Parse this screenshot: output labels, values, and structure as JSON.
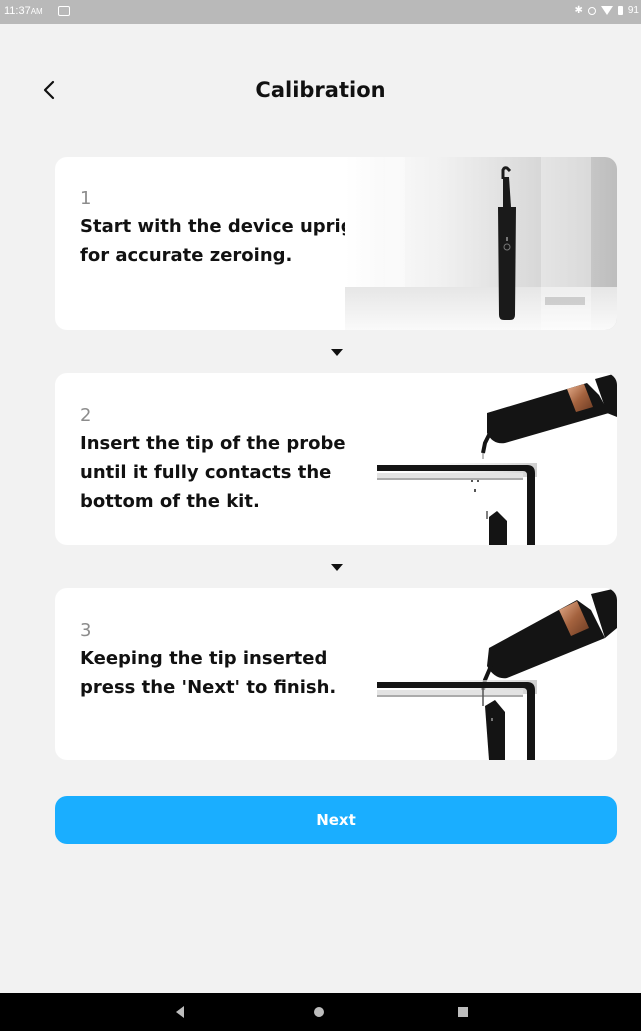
{
  "status_bar": {
    "time": "11:37",
    "time_suffix": "AM",
    "battery_level": "91"
  },
  "header": {
    "title": "Calibration",
    "back_icon": "chevron-left-icon"
  },
  "steps": [
    {
      "number": "1",
      "text": "Start with the device upright\nfor accurate zeroing.",
      "image": "device-upright-image"
    },
    {
      "number": "2",
      "text": "Insert the tip of the probe\nuntil it fully contacts the\nbottom of the kit.",
      "image": "probe-insert-image"
    },
    {
      "number": "3",
      "text": "Keeping the tip inserted\npress the 'Next' to finish.",
      "image": "probe-inserted-image"
    }
  ],
  "step_arrow_icon": "caret-down-icon",
  "actions": {
    "next_label": "Next"
  },
  "colors": {
    "background": "#f2f2f2",
    "card": "#ffffff",
    "accent": "#1aaeff",
    "device": "#1a1a1a",
    "copper": "#c0805a"
  },
  "nav_bar": {
    "back_icon": "nav-back-icon",
    "home_icon": "nav-home-icon",
    "recents_icon": "nav-recents-icon"
  }
}
